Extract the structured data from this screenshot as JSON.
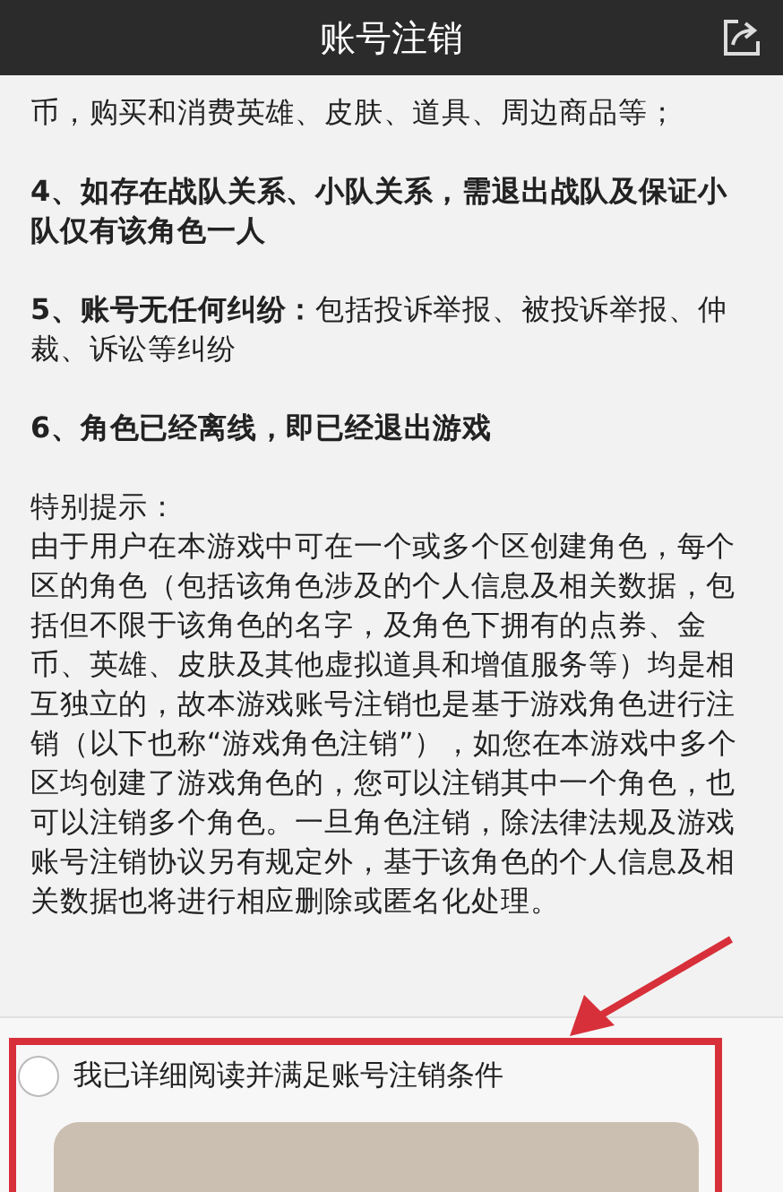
{
  "header": {
    "title": "账号注销"
  },
  "clauses": [
    {
      "text": "币，购买和消费英雄、皮肤、道具、周边商品等；",
      "bold": false
    },
    {
      "text": "4、如存在战队关系、小队关系，需退出战队及保证小队仅有该角色一人",
      "bold": true
    },
    {
      "text": "**5、账号无任何纠纷：**包括投诉举报、被投诉举报、仲裁、诉讼等纠纷",
      "bold": false
    },
    {
      "text": "6、角色已经离线，即已经退出游戏",
      "bold": true
    }
  ],
  "notice": {
    "title": "特别提示：",
    "body": "由于用户在本游戏中可在一个或多个区创建角色，每个区的角色（包括该角色涉及的个人信息及相关数据，包括但不限于该角色的名字，及角色下拥有的点券、金币、英雄、皮肤及其他虚拟道具和增值服务等）均是相互独立的，故本游戏账号注销也是基于游戏角色进行注销（以下也称“游戏角色注销”），如您在本游戏中多个区均创建了游戏角色的，您可以注销其中一个角色，也可以注销多个角色。一旦角色注销，除法律法规及游戏账号注销协议另有规定外，基于该角色的个人信息及相关数据也将进行相应删除或匿名化处理。"
  },
  "agreement": {
    "label": "我已详细阅读并满足账号注销条件",
    "checked": false
  }
}
